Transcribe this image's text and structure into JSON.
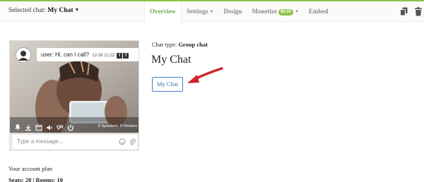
{
  "header": {
    "selected_label": "Selected chat:",
    "selected_value": "My Chat",
    "tabs": [
      {
        "label": "Overview",
        "active": true
      },
      {
        "label": "Settings",
        "dropdown": true
      },
      {
        "label": "Design"
      },
      {
        "label": "Monetize",
        "badge": "$0.00",
        "dropdown": true
      },
      {
        "label": "Embed"
      }
    ],
    "icons": [
      "copy-icon",
      "trash-icon"
    ]
  },
  "preview": {
    "message": {
      "user": "user:",
      "text": "Hi, can I call?",
      "time": "12-26 11:23",
      "social": [
        "twitter-icon",
        "facebook-icon"
      ]
    },
    "toolbar": {
      "qr_label": "QR",
      "speakers": "0",
      "speakers_label": "Speakers",
      "viewers": "0",
      "viewers_label": "Viewers"
    },
    "input_placeholder": "Type a message..."
  },
  "details": {
    "chat_type_label": "Chat type:",
    "chat_type_value": "Group chat",
    "chat_name": "My Chat",
    "button_label": "My Chat"
  },
  "plan": {
    "title": "Your account plan",
    "seats_label": "Seats:",
    "seats_value": "20",
    "separator": "|",
    "rooms_label": "Rooms:",
    "rooms_value": "10"
  },
  "colors": {
    "accent": "#8bc34a",
    "active_tab": "#6aa84f",
    "button_border": "#4a7cc9",
    "arrow": "#d0232a"
  }
}
